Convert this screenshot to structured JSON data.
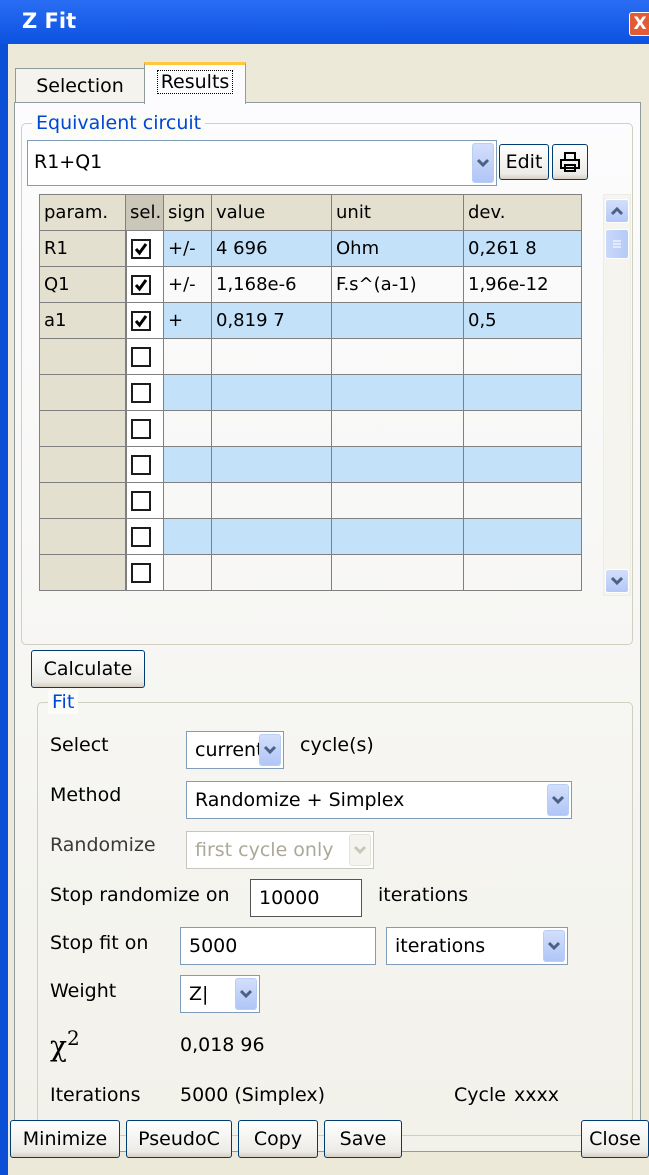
{
  "window": {
    "title": "Z Fit",
    "close_glyph": "X"
  },
  "tabs": [
    {
      "label": "Selection"
    },
    {
      "label": "Results"
    }
  ],
  "equivalent_circuit": {
    "group_label": "Equivalent circuit",
    "value": "R1+Q1",
    "edit_label": "Edit"
  },
  "table": {
    "headers": [
      "param.",
      "sel.",
      "sign",
      "value",
      "unit",
      "dev."
    ],
    "rows": [
      {
        "param": "R1",
        "sel": true,
        "sign": "+/-",
        "value": "4 696",
        "unit": "Ohm",
        "dev": "0,261 8"
      },
      {
        "param": "Q1",
        "sel": true,
        "sign": "+/-",
        "value": "1,168e-6",
        "unit": "F.s^(a-1)",
        "dev": "1,96e-12"
      },
      {
        "param": "a1",
        "sel": true,
        "sign": "+",
        "value": "0,819 7",
        "unit": "",
        "dev": "0,5"
      },
      {
        "param": "",
        "sel": false,
        "sign": "",
        "value": "",
        "unit": "",
        "dev": ""
      },
      {
        "param": "",
        "sel": false,
        "sign": "",
        "value": "",
        "unit": "",
        "dev": ""
      },
      {
        "param": "",
        "sel": false,
        "sign": "",
        "value": "",
        "unit": "",
        "dev": ""
      },
      {
        "param": "",
        "sel": false,
        "sign": "",
        "value": "",
        "unit": "",
        "dev": ""
      },
      {
        "param": "",
        "sel": false,
        "sign": "",
        "value": "",
        "unit": "",
        "dev": ""
      },
      {
        "param": "",
        "sel": false,
        "sign": "",
        "value": "",
        "unit": "",
        "dev": ""
      },
      {
        "param": "",
        "sel": false,
        "sign": "",
        "value": "",
        "unit": "",
        "dev": ""
      }
    ]
  },
  "calculate_label": "Calculate",
  "fit": {
    "group_label": "Fit",
    "select_label": "Select",
    "select_value": "current",
    "select_suffix": "cycle(s)",
    "method_label": "Method",
    "method_value": "Randomize + Simplex",
    "randomize_label": "Randomize",
    "randomize_value": "first cycle only",
    "stop_randomize_label": "Stop randomize on",
    "stop_randomize_value": "10000",
    "stop_randomize_suffix": "iterations",
    "stop_fit_label": "Stop fit on",
    "stop_fit_value": "5000",
    "stop_fit_unit": "iterations",
    "weight_label": "Weight",
    "weight_value": "Z|",
    "chi_symbol": "χ",
    "chi_exponent": "2",
    "chi_value": "0,018 96",
    "iterations_label": "Iterations",
    "iterations_value": "5000 (Simplex)",
    "cycle_label": "Cycle",
    "cycle_value": "xxxx"
  },
  "buttons": {
    "minimize": "Minimize",
    "pseudoc": "PseudoC",
    "copy": "Copy",
    "save": "Save",
    "close": "Close"
  },
  "colors": {
    "title_bar": "#0b52e0",
    "accent_label": "#0046d5",
    "row_highlight": "#c3e1f8",
    "face": "#ece9d8"
  }
}
